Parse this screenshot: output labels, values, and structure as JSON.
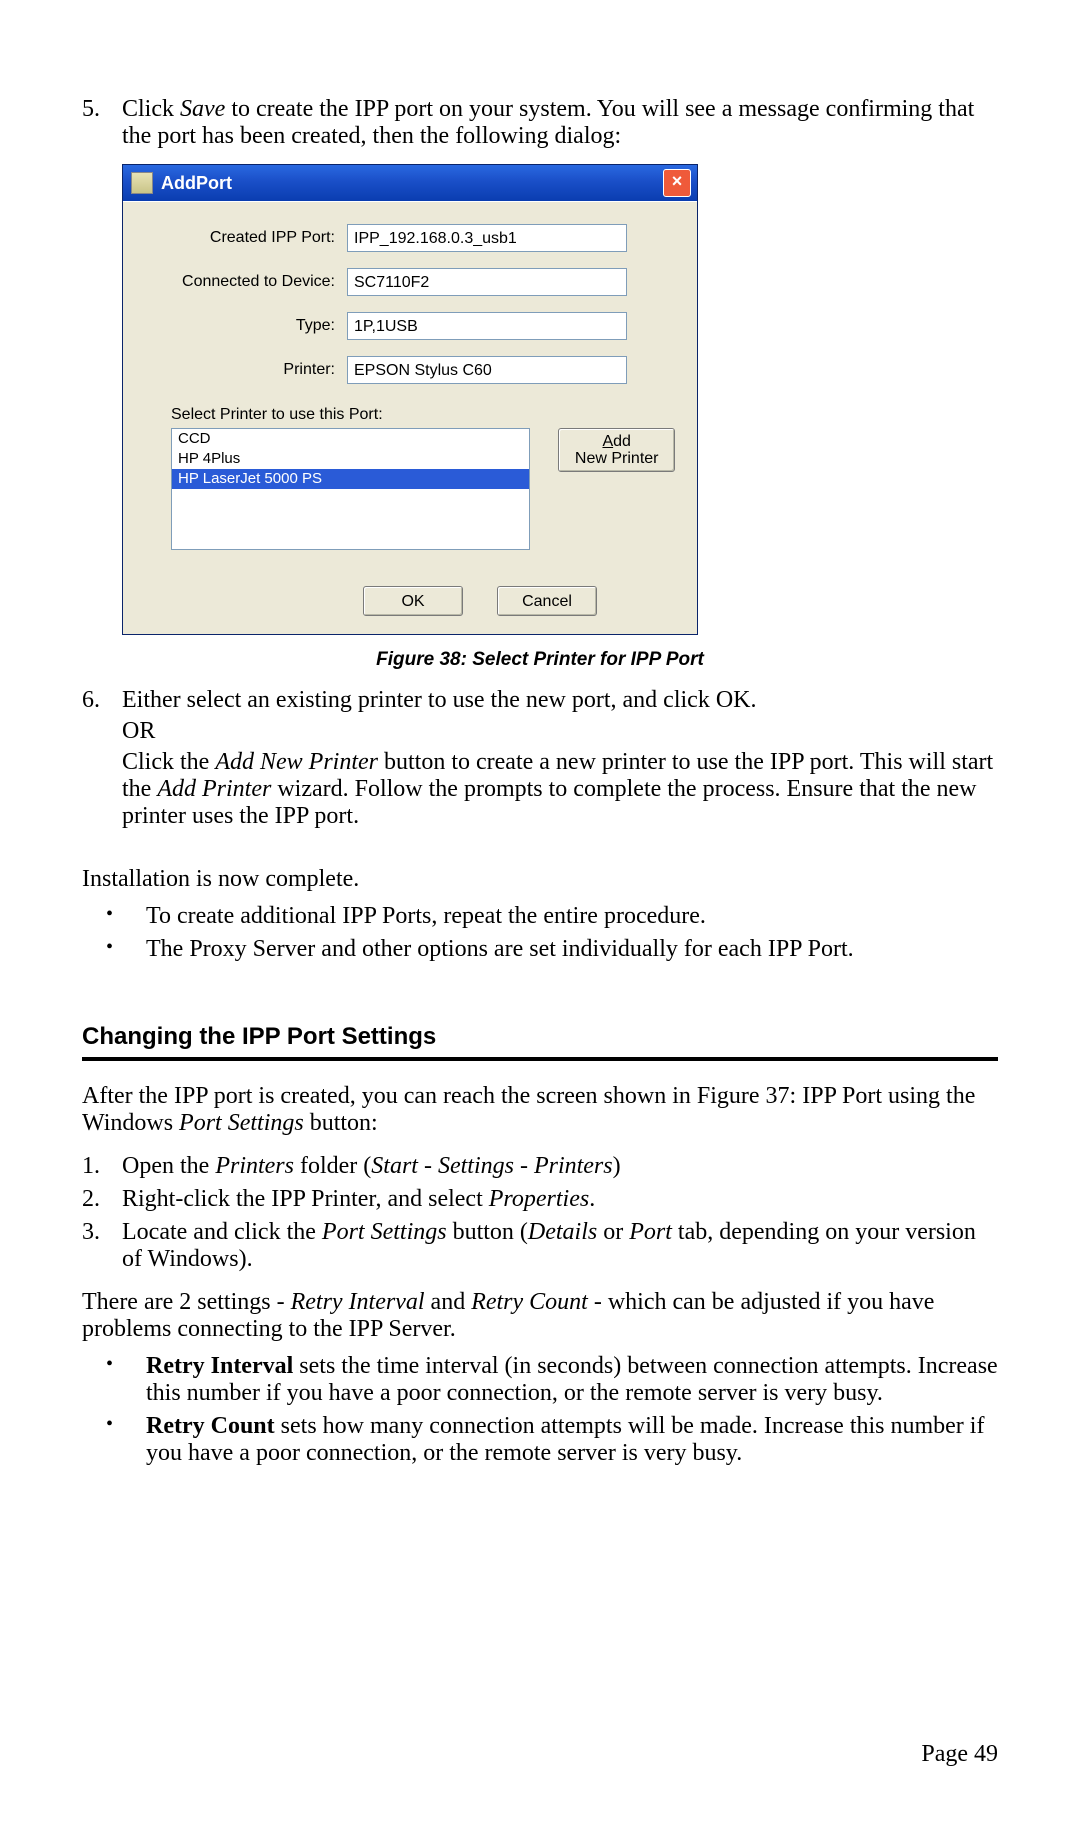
{
  "step5": {
    "num": "5.",
    "text_a": "Click ",
    "text_save": "Save",
    "text_b": " to create the IPP port on your system. You will see a message confirming that the port has been created, then the following dialog:"
  },
  "dialog": {
    "title": "AddPort",
    "close": "×",
    "rows": {
      "created_label": "Created IPP Port:",
      "created_value": "IPP_192.168.0.3_usb1",
      "device_label": "Connected to Device:",
      "device_value": "SC7110F2",
      "type_label": "Type:",
      "type_value": "1P,1USB",
      "printer_label": "Printer:",
      "printer_value": "EPSON Stylus C60"
    },
    "select_label": "Select Printer to use this Port:",
    "items": {
      "i0": "CCD",
      "i1": "HP 4Plus",
      "i2": "HP LaserJet 5000 PS"
    },
    "add_btn_l1": "A",
    "add_btn_l1b": "dd",
    "add_btn_l2": "New Printer",
    "ok": "OK",
    "cancel": "Cancel"
  },
  "caption": "Figure 38: Select Printer for IPP Port",
  "step6": {
    "num": "6.",
    "line_a": "Either select an existing printer to use the new port, and click OK.",
    "or": "OR",
    "line_b_a": "Click the ",
    "line_b_i": "Add New Printer",
    "line_b_b": " button to create a new printer to use the IPP port. This will start the ",
    "line_b_i2": "Add Printer",
    "line_b_c": " wizard. Follow the prompts to complete the process. Ensure that the new printer uses the IPP port."
  },
  "inst_complete": "Installation is now complete.",
  "bul_a": "To create additional IPP Ports, repeat the entire procedure.",
  "bul_b": "The Proxy Server and other options are set individually for each IPP Port.",
  "heading": "Changing the IPP Port Settings",
  "after": {
    "a": "After the IPP port is created, you can reach the screen shown in Figure 37: IPP Port using the Windows ",
    "i": "Port Settings",
    "b": " button:"
  },
  "s1": {
    "num": "1.",
    "a": "Open the ",
    "i1": "Printers",
    "b": " folder (",
    "i2": "Start - Settings - Printers",
    "c": ")"
  },
  "s2": {
    "num": "2.",
    "a": "Right-click the IPP Printer, and select ",
    "i": "Properties",
    "b": "."
  },
  "s3": {
    "num": "3.",
    "a": "Locate and click the ",
    "i1": "Port Settings",
    "b": " button (",
    "i2": "Details",
    "c": " or ",
    "i3": "Port",
    "d": " tab, depending on your version of Windows)."
  },
  "settings_intro": {
    "a": "There are 2 settings - ",
    "i1": "Retry Interval",
    "b": " and ",
    "i2": "Retry Count",
    "c": " - which can be adjusted if you have problems connecting to the IPP Server."
  },
  "ri": {
    "b": "Retry Interval",
    "t": " sets the time interval (in seconds) between connection attempts. Increase this number if you have a poor connection, or the remote server is very busy."
  },
  "rc": {
    "b": "Retry Count",
    "t": " sets how many connection attempts will be made. Increase this number if you have a poor connection, or the remote server is very busy."
  },
  "footer": "Page 49"
}
